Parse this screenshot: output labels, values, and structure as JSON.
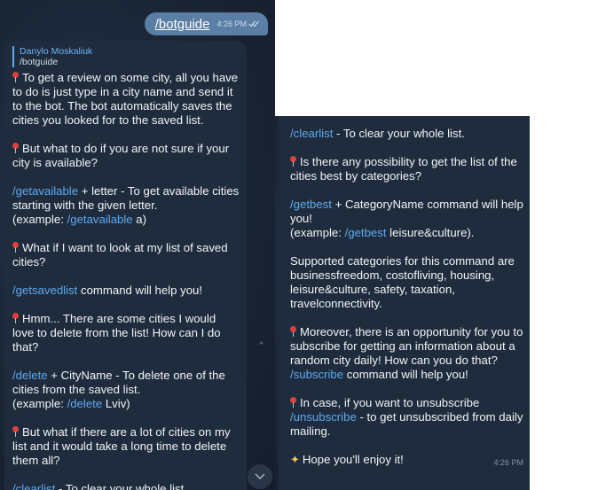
{
  "sent_message": {
    "command": "/botguide",
    "time": "4:26 PM",
    "status_icon": "double-check-icon"
  },
  "reply": {
    "author": "Danylo Moskaliuk",
    "quote": "/botguide"
  },
  "left": {
    "p1": "To get a review on some city, all you have to do is just type in a city name and send it to the bot. The bot automatically saves the cities you looked for to the saved list.",
    "p2": "But what to do if you are not sure if your city is available?",
    "p3_cmd": "/getavailable",
    "p3_text": " + letter - To get available cities starting with the given letter.",
    "p3_ex_prefix": "(example: ",
    "p3_ex_cmd": "/getavailable",
    "p3_ex_suffix": " a)",
    "p4": "What if I want to look at my list of saved cities?",
    "p5_cmd": "/getsavedlist",
    "p5_text": " command will help you!",
    "p6": "Hmm... There are some cities I would love to delete from the list! How can I do that?",
    "p7_cmd": "/delete",
    "p7_text": " + CityName - To delete one of the cities from the saved list.",
    "p7_ex_prefix": "(example: ",
    "p7_ex_cmd": "/delete",
    "p7_ex_suffix": " Lviv)",
    "p8": "But what if there are a lot of cities on my list and it would take a long time to delete them all?",
    "p9_cmd": "/clearlist",
    "p9_text": " - To clear your whole list."
  },
  "right": {
    "r1_cmd": "/clearlist",
    "r1_text": " - To clear your whole list.",
    "r2": "Is there any possibility to get the list of the cities best by categories?",
    "r3_cmd": "/getbest",
    "r3_text": " + CategoryName command will help you!",
    "r3_ex_prefix": "(example: ",
    "r3_ex_cmd": "/getbest",
    "r3_ex_suffix": " leisure&culture).",
    "r4": "Supported categories for this command are businessfreedom, costofliving, housing, leisure&culture, safety, taxation, travelconnectivity.",
    "r5_text": "Moreover, there is an opportunity for you to subscribe for getting an information about a random city daily! How can you do that? ",
    "r5_cmd": "/subscribe",
    "r5_suffix": " command will help you!",
    "r6_text": "In case, if you want to unsubscribe ",
    "r6_cmd": "/unsubscribe",
    "r6_suffix": " - to get unsubscribed from daily mailing.",
    "r7": "Hope you'll enjoy it!",
    "time": "4:26 PM"
  }
}
